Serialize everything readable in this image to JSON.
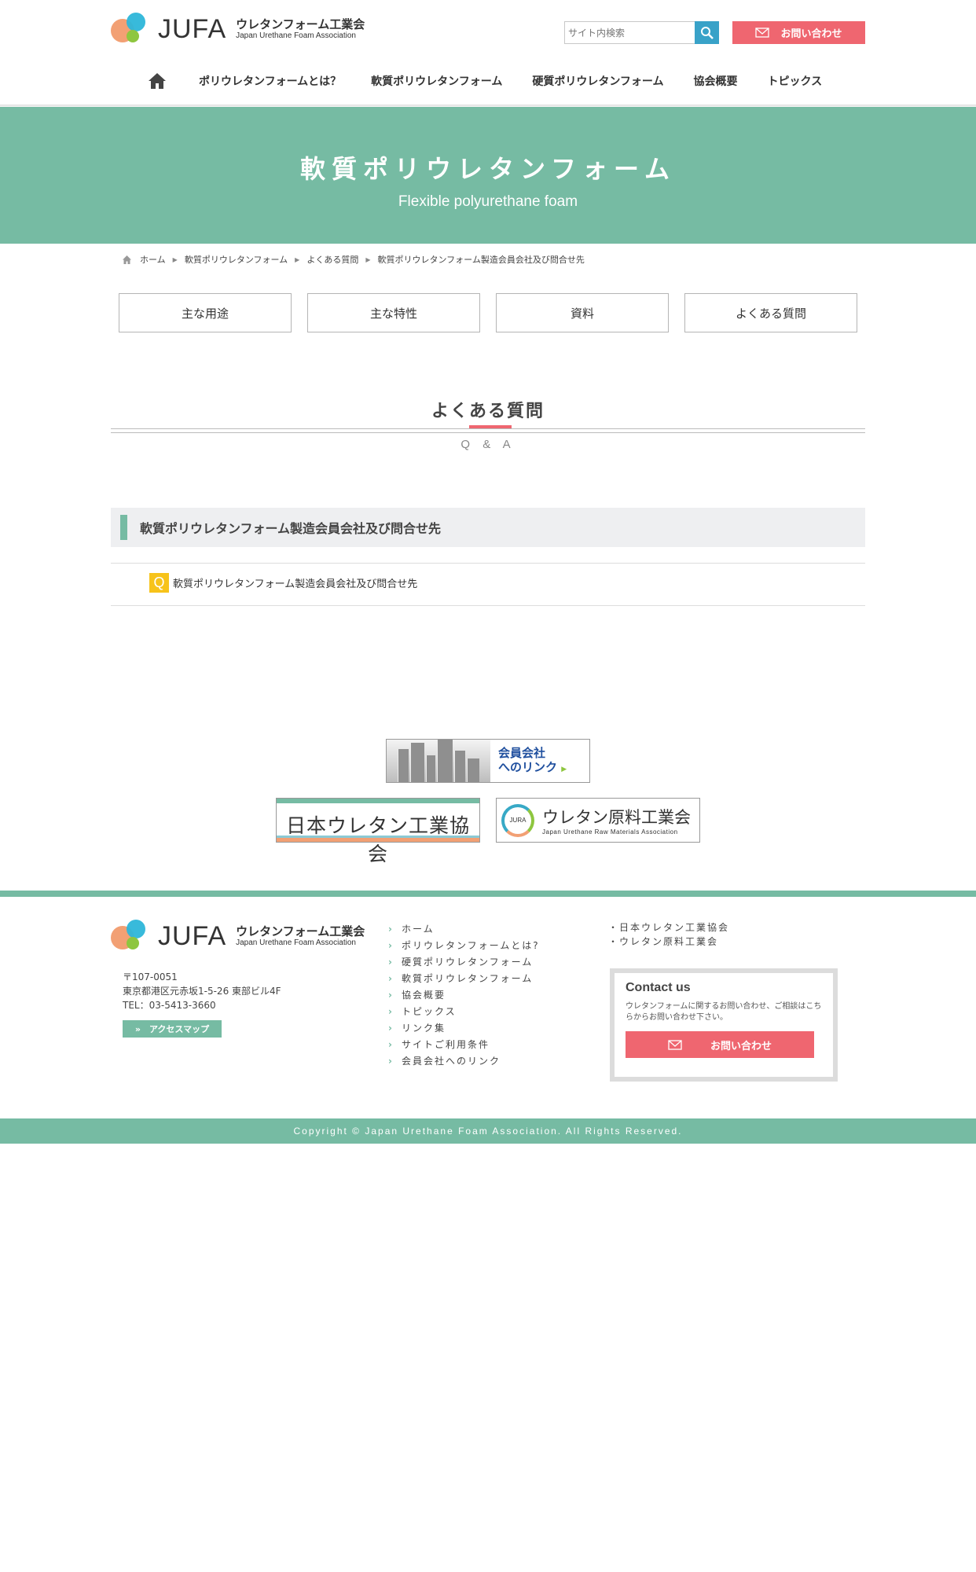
{
  "header": {
    "logo_mark": "JUFA",
    "logo_jp": "ウレタンフォーム工業会",
    "logo_en": "Japan Urethane Foam Association",
    "search_placeholder": "サイト内検索",
    "contact_label": "お問い合わせ"
  },
  "nav": {
    "items": [
      "ポリウレタンフォームとは？",
      "軟質ポリウレタンフォーム",
      "硬質ポリウレタンフォーム",
      "協会概要",
      "トピックス"
    ]
  },
  "hero": {
    "title": "軟質ポリウレタンフォーム",
    "subtitle": "Flexible polyurethane foam"
  },
  "breadcrumb": [
    "ホーム",
    "軟質ポリウレタンフォーム",
    "よくある質問",
    "軟質ポリウレタンフォーム製造会員会社及び問合せ先"
  ],
  "tabs": [
    "主な用途",
    "主な特性",
    "資料",
    "よくある質問"
  ],
  "section": {
    "title": "よくある質問",
    "subtitle": "Q & A"
  },
  "faq": {
    "heading": "軟質ポリウレタンフォーム製造会員会社及び問合せ先",
    "q_mark": "Q",
    "question": "軟質ポリウレタンフォーム製造会員会社及び問合せ先"
  },
  "banners": {
    "member_line1": "会員会社",
    "member_line2": "へのリンク",
    "jpu": "日本ウレタン工業協会",
    "jura_mark": "JURA",
    "jura_jp": "ウレタン原料工業会",
    "jura_en": "Japan Urethane Raw Materials Association"
  },
  "footer": {
    "logo_mark": "JUFA",
    "logo_jp": "ウレタンフォーム工業会",
    "logo_en": "Japan Urethane Foam Association",
    "postal": "〒107-0051",
    "address": "東京都港区元赤坂1-5-26 東部ビル4F",
    "tel": "TEL：03-5413-3660",
    "access_label": "»　アクセスマップ",
    "links": [
      "ホーム",
      "ポリウレタンフォームとは?",
      "硬質ポリウレタンフォーム",
      "軟質ポリウレタンフォーム",
      "協会概要",
      "トピックス",
      "リンク集",
      "サイトご利用条件",
      "会員会社へのリンク"
    ],
    "external": [
      "日本ウレタン工業協会",
      "ウレタン原料工業会"
    ],
    "contact_title": "Contact us",
    "contact_text": "ウレタンフォームに関するお問い合わせ、ご相談はこちらからお問い合わせ下さい。",
    "contact_button": "お問い合わせ",
    "copyright": "Copyright © Japan Urethane Foam Association. All Rights Reserved."
  },
  "colors": {
    "accent_green": "#76bba3",
    "accent_pink": "#ef6670",
    "q_yellow": "#f7c31a"
  }
}
